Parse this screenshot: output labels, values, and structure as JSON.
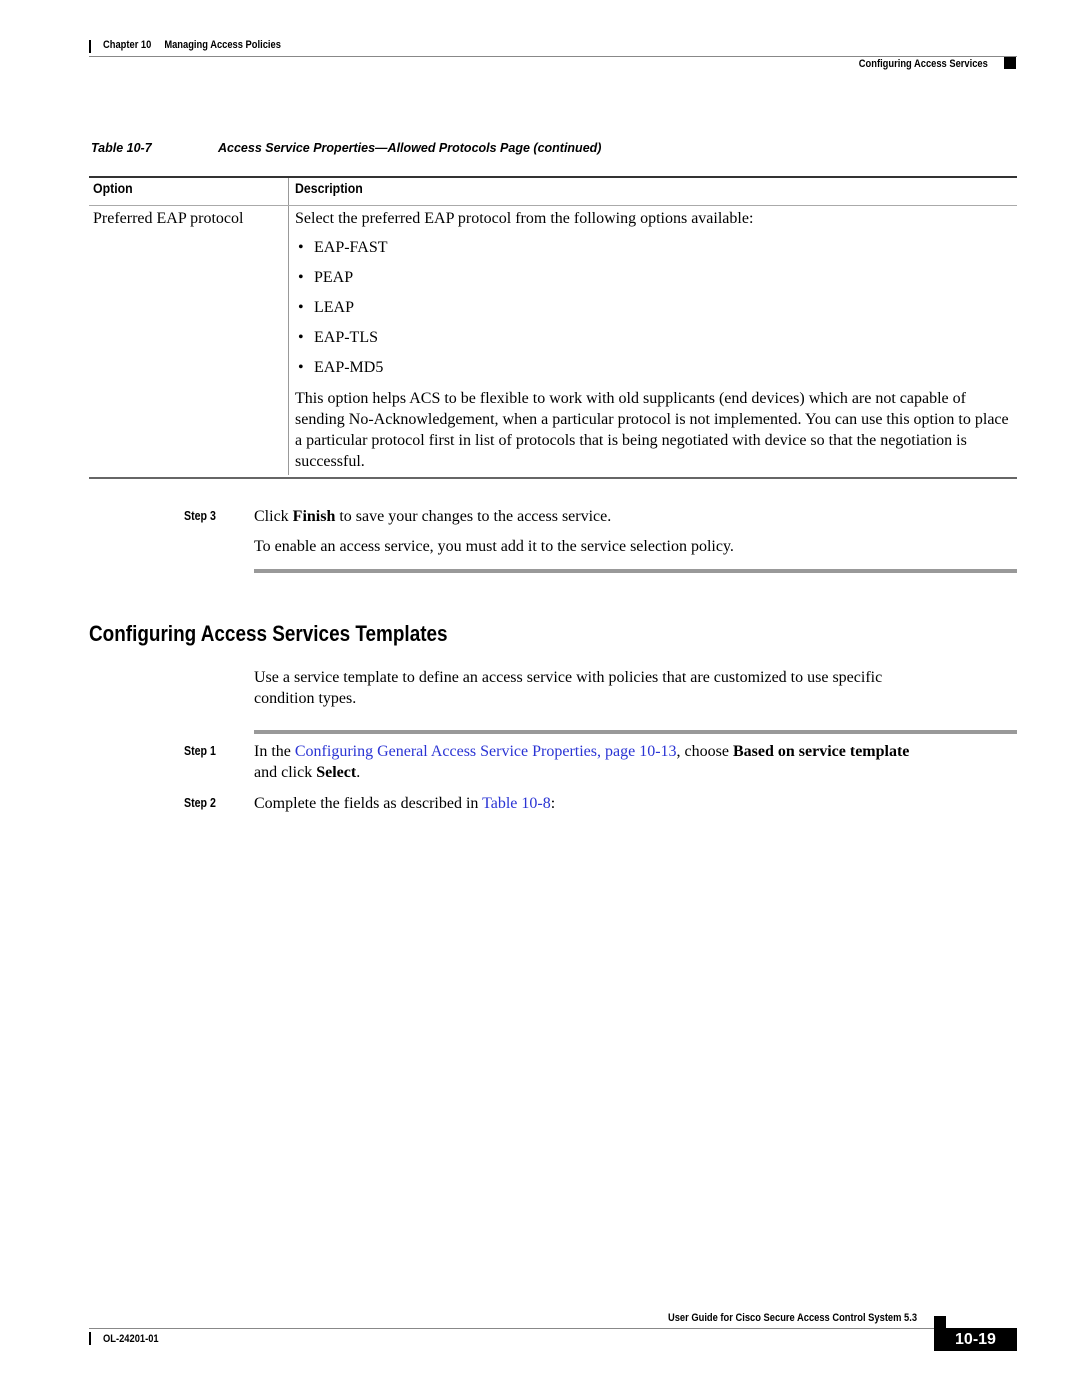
{
  "header": {
    "chapter_label": "Chapter 10",
    "chapter_title": "Managing Access Policies",
    "section_title": "Configuring Access Services"
  },
  "table": {
    "caption_number": "Table 10-7",
    "caption_title": "Access Service Properties—Allowed Protocols Page (continued)",
    "columns": [
      "Option",
      "Description"
    ],
    "rows": [
      {
        "option": "Preferred EAP protocol",
        "description_intro": "Select the preferred EAP protocol from the following options available:",
        "bullets": [
          "EAP-FAST",
          "PEAP",
          "LEAP",
          "EAP-TLS",
          "EAP-MD5"
        ],
        "description_note": "This option helps ACS to be flexible to work with old supplicants (end devices) which are not capable of sending No-Acknowledgement, when a particular protocol is not implemented. You can use this option to place a particular protocol first in list of protocols that is being negotiated with device so that the negotiation is successful."
      }
    ]
  },
  "steps_a": {
    "step3": {
      "label": "Step 3",
      "text_before": "Click ",
      "bold": "Finish",
      "text_after": " to save your changes to the access service.",
      "followup": "To enable an access service, you must add it to the service selection policy."
    }
  },
  "section": {
    "heading": "Configuring Access Services Templates",
    "intro_line1": "Use a service template to define an access service with policies that are customized to use specific",
    "intro_line2": "condition types."
  },
  "steps_b": {
    "step1": {
      "label": "Step 1",
      "text_before": "In the ",
      "link": "Configuring General Access Service Properties, page 10-13",
      "text_mid": ", choose ",
      "bold1": "Based on service template",
      "line2_before": "and click ",
      "bold2": "Select",
      "line2_after": "."
    },
    "step2": {
      "label": "Step 2",
      "text_before": "Complete the fields as described in ",
      "link": "Table 10-8",
      "text_after": ":"
    }
  },
  "footer": {
    "guide_title": "User Guide for Cisco Secure Access Control System 5.3",
    "doc_number": "OL-24201-01",
    "page_number": "10-19"
  },
  "colors": {
    "link": "#2a34d4"
  }
}
